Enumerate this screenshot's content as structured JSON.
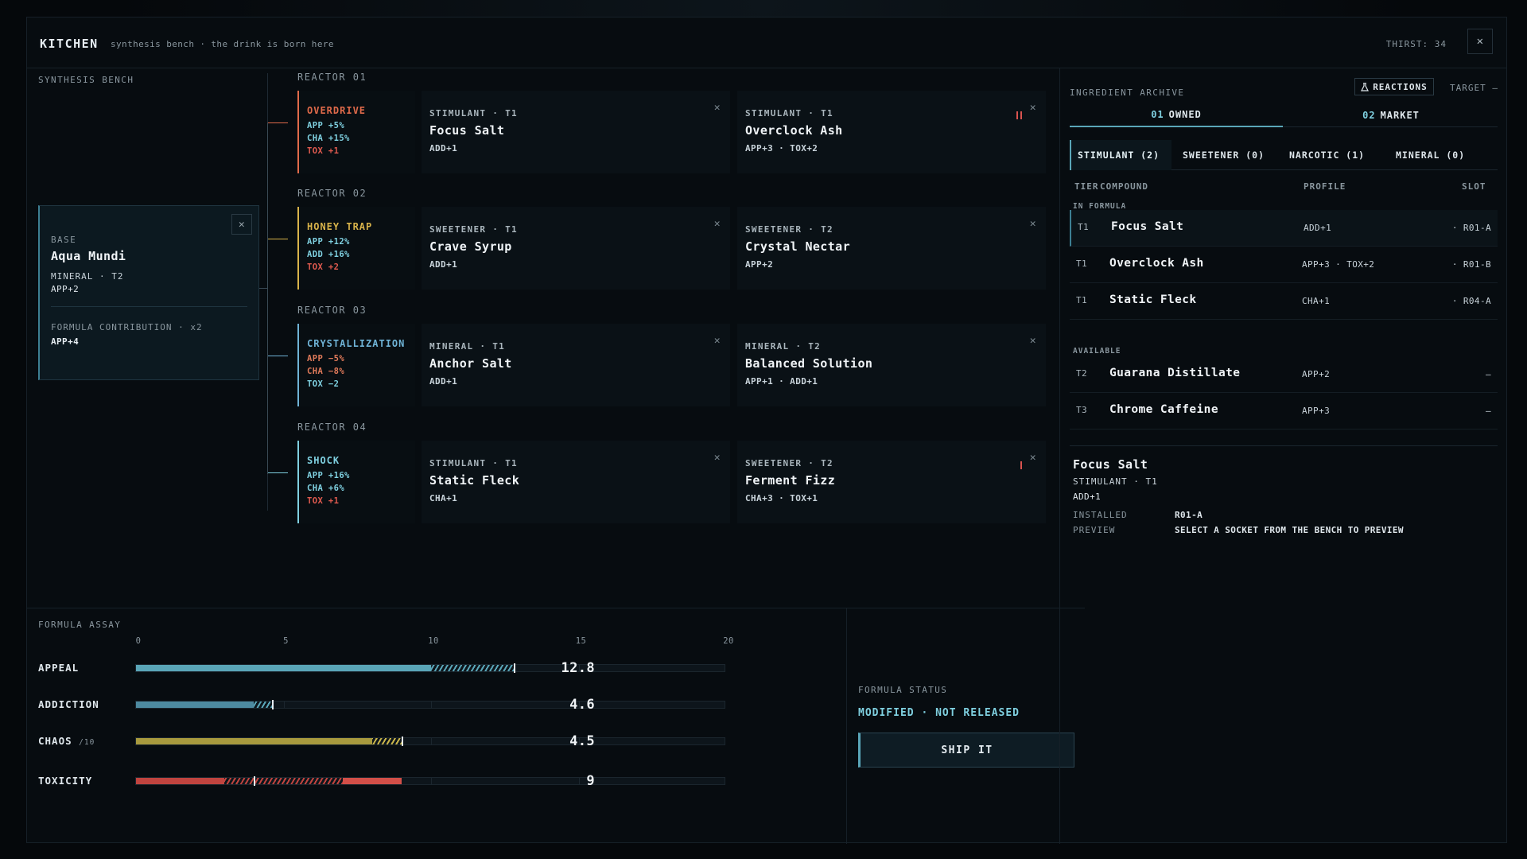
{
  "header": {
    "title": "KITCHEN",
    "tagline": "synthesis bench · the drink is born here",
    "thirst": "THIRST: 34",
    "close": "✕"
  },
  "bench": {
    "title": "SYNTHESIS BENCH",
    "base": {
      "label": "BASE",
      "name": "Aqua Mundi",
      "meta": "MINERAL · T2",
      "mod": "APP+2",
      "contribution_label": "FORMULA CONTRIBUTION · x2",
      "contribution_value": "APP+4",
      "close": "✕"
    },
    "reactors": [
      {
        "label": "REACTOR 01",
        "name": "OVERDRIVE",
        "color": "#e06a4a",
        "lines": [
          {
            "text": "APP +5%",
            "color": "#7fd0e0"
          },
          {
            "text": "CHA +15%",
            "color": "#7fd0e0"
          },
          {
            "text": "TOX +1",
            "color": "#e05a4f"
          }
        ],
        "slots": [
          {
            "type": "STIMULANT · T1",
            "name": "Focus Salt",
            "mod": "ADD+1",
            "warn": false
          },
          {
            "type": "STIMULANT · T1",
            "name": "Overclock Ash",
            "mod": "APP+3 · TOX+2",
            "warn": true
          }
        ]
      },
      {
        "label": "REACTOR 02",
        "name": "HONEY TRAP",
        "color": "#d8b34a",
        "lines": [
          {
            "text": "APP +12%",
            "color": "#7fd0e0"
          },
          {
            "text": "ADD +16%",
            "color": "#7fd0e0"
          },
          {
            "text": "TOX +2",
            "color": "#e05a4f"
          }
        ],
        "slots": [
          {
            "type": "SWEETENER · T1",
            "name": "Crave Syrup",
            "mod": "ADD+1",
            "warn": false
          },
          {
            "type": "SWEETENER · T2",
            "name": "Crystal Nectar",
            "mod": "APP+2",
            "warn": false
          }
        ]
      },
      {
        "label": "REACTOR 03",
        "name": "CRYSTALLIZATION",
        "color": "#6fb3d6",
        "lines": [
          {
            "text": "APP −5%",
            "color": "#e07a5a"
          },
          {
            "text": "CHA −8%",
            "color": "#e07a5a"
          },
          {
            "text": "TOX −2",
            "color": "#7fd0e0"
          }
        ],
        "slots": [
          {
            "type": "MINERAL · T1",
            "name": "Anchor Salt",
            "mod": "ADD+1",
            "warn": false
          },
          {
            "type": "MINERAL · T2",
            "name": "Balanced Solution",
            "mod": "APP+1 · ADD+1",
            "warn": false
          }
        ]
      },
      {
        "label": "REACTOR 04",
        "name": "SHOCK",
        "color": "#7fd0e0",
        "lines": [
          {
            "text": "APP +16%",
            "color": "#7fd0e0"
          },
          {
            "text": "CHA +6%",
            "color": "#7fd0e0"
          },
          {
            "text": "TOX +1",
            "color": "#e05a4f"
          }
        ],
        "slots": [
          {
            "type": "STIMULANT · T1",
            "name": "Static Fleck",
            "mod": "CHA+1",
            "warn": false
          },
          {
            "type": "SWEETENER · T2",
            "name": "Ferment Fizz",
            "mod": "CHA+3 · TOX+1",
            "warn": true
          }
        ]
      }
    ]
  },
  "assay": {
    "title": "FORMULA ASSAY",
    "ticks": [
      "0",
      "5",
      "10",
      "15",
      "20"
    ],
    "max": 20,
    "stats": [
      {
        "label": "APPEAL",
        "suffix": "",
        "value": "12.8",
        "base": 10,
        "total": 12.8,
        "color": "#5aa6b8",
        "hatch_color": "#5aa6b8",
        "marker": 12.8
      },
      {
        "label": "ADDICTION",
        "suffix": "",
        "value": "4.6",
        "base": 4,
        "total": 4.6,
        "color": "#4d8aa0",
        "hatch_color": "#5aa6b8",
        "marker": 4.6
      },
      {
        "label": "CHAOS",
        "suffix": "/10",
        "value": "4.5",
        "base": 8,
        "total": 9,
        "color": "#a89a3e",
        "hatch_color": "#c9b54a",
        "marker": 9
      },
      {
        "label": "TOXICITY",
        "suffix": "",
        "value": "9",
        "base": 3,
        "total": 9,
        "color": "#c0443f",
        "hatch_color": "#c0443f",
        "marker": 4,
        "tail_from": 7,
        "tail_color": "#d24f48"
      }
    ]
  },
  "status": {
    "label": "FORMULA STATUS",
    "value": "MODIFIED · NOT RELEASED",
    "ship": "SHIP IT"
  },
  "archive": {
    "title": "INGREDIENT ARCHIVE",
    "reactions": "REACTIONS",
    "target": "TARGET —",
    "tabs": [
      {
        "n": "01",
        "label": "OWNED"
      },
      {
        "n": "02",
        "label": "MARKET"
      }
    ],
    "cats": [
      "STIMULANT (2)",
      "SWEETENER (0)",
      "NARCOTIC (1)",
      "MINERAL (0)"
    ],
    "cols": {
      "tier": "TIER",
      "compound": "COMPOUND",
      "profile": "PROFILE",
      "slot": "SLOT"
    },
    "in_formula_label": "IN FORMULA",
    "available_label": "AVAILABLE",
    "in_formula": [
      {
        "tier": "T1",
        "name": "Focus Salt",
        "profile": "ADD+1",
        "slot": "· R01-A"
      },
      {
        "tier": "T1",
        "name": "Overclock Ash",
        "profile": "APP+3 · TOX+2",
        "slot": "· R01-B"
      },
      {
        "tier": "T1",
        "name": "Static Fleck",
        "profile": "CHA+1",
        "slot": "· R04-A"
      }
    ],
    "available": [
      {
        "tier": "T2",
        "name": "Guarana Distillate",
        "profile": "APP+2",
        "slot": "—"
      },
      {
        "tier": "T3",
        "name": "Chrome Caffeine",
        "profile": "APP+3",
        "slot": "—"
      }
    ],
    "detail": {
      "name": "Focus Salt",
      "sub": "STIMULANT · T1",
      "mod": "ADD+1",
      "installed_label": "INSTALLED",
      "installed_value": "R01-A",
      "preview_label": "PREVIEW",
      "preview_value": "SELECT A SOCKET FROM THE BENCH TO PREVIEW"
    }
  }
}
